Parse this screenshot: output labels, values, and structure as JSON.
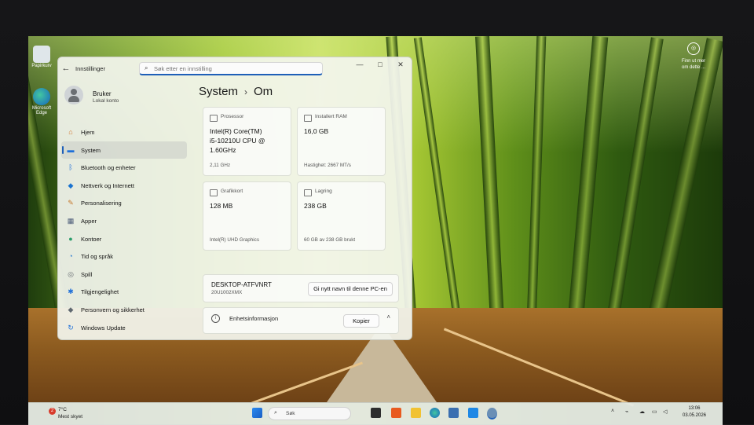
{
  "window": {
    "app_title": "Innstillinger",
    "search_placeholder": "Søk etter en innstilling",
    "controls": {
      "minimize": "—",
      "maximize": "□",
      "close": "✕"
    }
  },
  "user": {
    "name": "Bruker",
    "role": "Lokal konto"
  },
  "nav": [
    {
      "label": "Hjem",
      "icon": "home-icon",
      "glyph": "⌂",
      "color": "#d2772b"
    },
    {
      "label": "System",
      "icon": "monitor-icon",
      "glyph": "▬",
      "color": "#1e6fd9",
      "selected": true
    },
    {
      "label": "Bluetooth og enheter",
      "icon": "bluetooth-icon",
      "glyph": "ᛒ",
      "color": "#1e6fd9"
    },
    {
      "label": "Nettverk og Internett",
      "icon": "wifi-icon",
      "glyph": "◆",
      "color": "#1a73d0"
    },
    {
      "label": "Personalisering",
      "icon": "brush-icon",
      "glyph": "✎",
      "color": "#c5792c"
    },
    {
      "label": "Apper",
      "icon": "apps-icon",
      "glyph": "▦",
      "color": "#4b5b78"
    },
    {
      "label": "Kontoer",
      "icon": "account-icon",
      "glyph": "●",
      "color": "#2a9d6a"
    },
    {
      "label": "Tid og språk",
      "icon": "globe-clock-icon",
      "glyph": "◔",
      "color": "#2f7fd0"
    },
    {
      "label": "Spill",
      "icon": "gamepad-icon",
      "glyph": "◎",
      "color": "#666c72"
    },
    {
      "label": "Tilgjengelighet",
      "icon": "accessibility-icon",
      "glyph": "✱",
      "color": "#1e6fd9"
    },
    {
      "label": "Personvern og sikkerhet",
      "icon": "shield-icon",
      "glyph": "◆",
      "color": "#606870"
    },
    {
      "label": "Windows Update",
      "icon": "update-icon",
      "glyph": "↻",
      "color": "#1e6fd9"
    }
  ],
  "page": {
    "crumb_parent": "System",
    "crumb_sep": "›",
    "crumb_current": "Om"
  },
  "specs": {
    "cpu": {
      "label": "Prosessor",
      "value_lines": [
        "Intel(R) Core(TM)",
        "i5-10210U CPU @",
        "1.60GHz"
      ],
      "sub": "2,11 GHz"
    },
    "ram": {
      "label": "Installert RAM",
      "value": "16,0 GB",
      "sub": "Hastighet: 2667 MT/s"
    },
    "gpu": {
      "label": "Grafikkort",
      "value": "128 MB",
      "sub": "Intel(R) UHD Graphics"
    },
    "storage": {
      "label": "Lagring",
      "value": "238 GB",
      "sub": "60 GB av 238 GB brukt"
    }
  },
  "device": {
    "name": "DESKTOP-ATFVNRT",
    "model": "20U1002XMX",
    "rename_button": "Gi nytt navn til denne PC-en"
  },
  "device_info": {
    "label": "Enhetsinformasjon",
    "copy_button": "Kopier",
    "chevron": "˄"
  },
  "desktop_icons": [
    {
      "label": "Papirkurv",
      "icon": "recycle-bin-icon"
    },
    {
      "label": "Microsoft Edge",
      "icon": "edge-icon"
    }
  ],
  "widget": {
    "line1": "Finn ut mer",
    "line2": "om dette ..."
  },
  "taskbar": {
    "weather_badge": "2",
    "temperature": "7°C",
    "condition": "Mest skyet",
    "search_label": "Søk",
    "time": "13:06",
    "date": "03.05.2026"
  }
}
